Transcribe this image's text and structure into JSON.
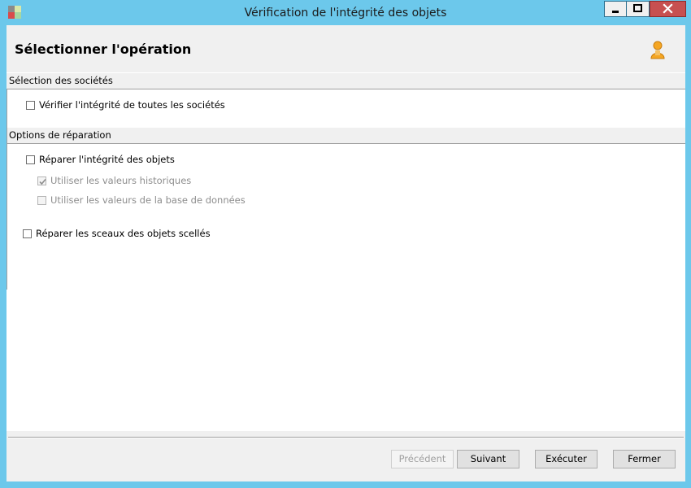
{
  "window": {
    "title": "Vérification de l'intégrité des objets",
    "colors": {
      "frame": "#6cc8eb",
      "close": "#c75050",
      "client": "#ffffff",
      "panel": "#f0f0f0"
    }
  },
  "header": {
    "title": "Sélectionner l'opération",
    "icon": "user-icon"
  },
  "sections": {
    "companies": {
      "label": "Sélection des sociétés",
      "verify_all": {
        "label": "Vérifier l'intégrité de toutes les sociétés",
        "checked": false,
        "enabled": true
      }
    },
    "repair": {
      "label": "Options de réparation",
      "repair_integrity": {
        "label": "Réparer l'intégrité des objets",
        "checked": false,
        "enabled": true
      },
      "use_historical": {
        "label": "Utiliser les valeurs historiques",
        "checked": true,
        "enabled": false
      },
      "use_database": {
        "label": "Utiliser les valeurs de la base de données",
        "checked": false,
        "enabled": false
      },
      "repair_seals": {
        "label": "Réparer les sceaux des objets scellés",
        "checked": false,
        "enabled": true
      }
    }
  },
  "footer": {
    "previous": "Précédent",
    "next": "Suivant",
    "execute": "Exécuter",
    "close": "Fermer"
  }
}
